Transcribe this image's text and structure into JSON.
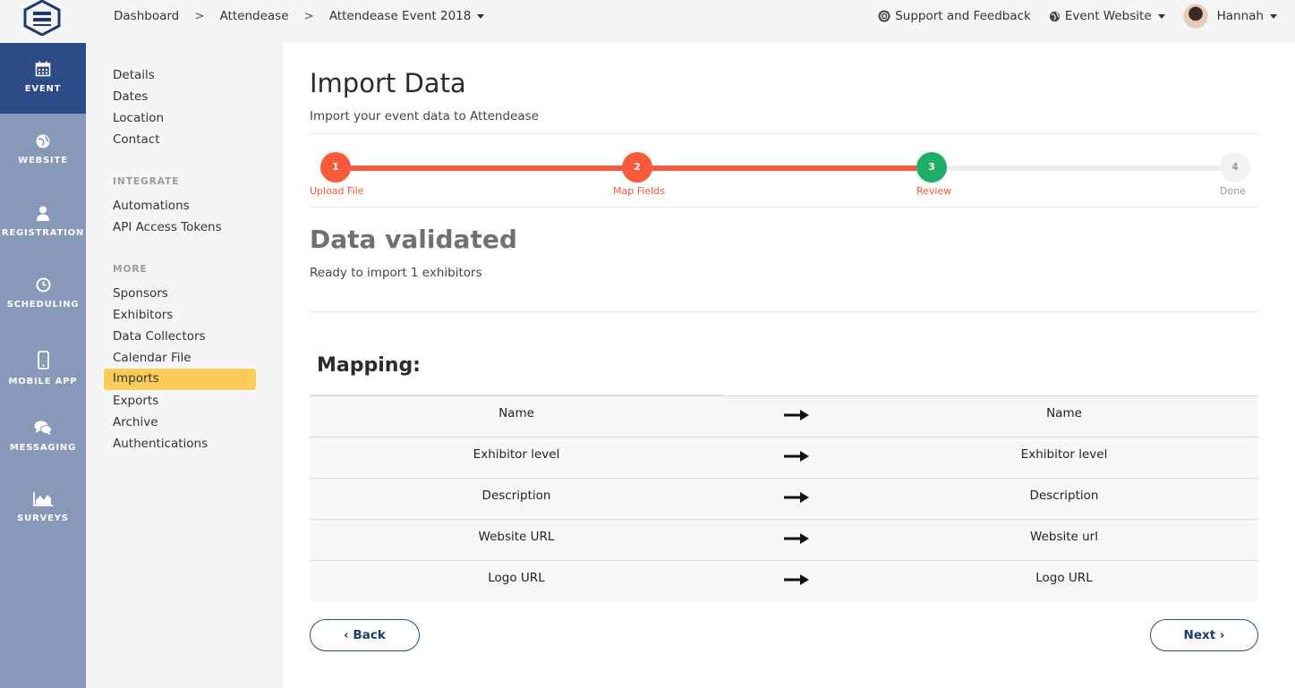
{
  "header": {
    "breadcrumbs": [
      "Dashboard",
      "Attendease",
      "Attendease Event 2018"
    ],
    "breadcrumb_sep": ">",
    "support_label": "Support and Feedback",
    "website_label": "Event Website",
    "user_name": "Hannah"
  },
  "rail": {
    "items": [
      {
        "label": "EVENT",
        "icon": "calendar-icon"
      },
      {
        "label": "WEBSITE",
        "icon": "globe-icon"
      },
      {
        "label": "REGISTRATION",
        "icon": "user-icon"
      },
      {
        "label": "SCHEDULING",
        "icon": "clock-icon"
      },
      {
        "label": "MOBILE APP",
        "icon": "phone-icon"
      },
      {
        "label": "MESSAGING",
        "icon": "chat-icon"
      },
      {
        "label": "SURVEYS",
        "icon": "chart-icon"
      }
    ]
  },
  "subnav": {
    "group1": [
      "Details",
      "Dates",
      "Location",
      "Contact"
    ],
    "integrate_heading": "INTEGRATE",
    "group2": [
      "Automations",
      "API Access Tokens"
    ],
    "more_heading": "MORE",
    "group3": [
      "Sponsors",
      "Exhibitors",
      "Data Collectors",
      "Calendar File",
      "Imports",
      "Exports",
      "Archive",
      "Authentications"
    ]
  },
  "page": {
    "title": "Import Data",
    "subtitle": "Import your event data to Attendease",
    "steps": [
      {
        "number": "1",
        "label": "Upload File"
      },
      {
        "number": "2",
        "label": "Map Fields"
      },
      {
        "number": "3",
        "label": "Review"
      },
      {
        "number": "4",
        "label": "Done"
      }
    ],
    "status_title": "Data validated",
    "status_text": "Ready to import 1 exhibitors",
    "mapping_title": "Mapping:",
    "mapping": [
      {
        "source": "Name",
        "target": "Name"
      },
      {
        "source": "Exhibitor level",
        "target": "Exhibitor level"
      },
      {
        "source": "Description",
        "target": "Description"
      },
      {
        "source": "Website URL",
        "target": "Website url"
      },
      {
        "source": "Logo URL",
        "target": "Logo URL"
      }
    ],
    "back_label": "‹ Back",
    "next_label": "Next ›"
  },
  "colors": {
    "rail_bg": "#8798b9",
    "rail_active": "#2d4b87",
    "step_done": "#fa5a3c",
    "step_current": "#1fae6a",
    "highlight": "#fdcb5a"
  }
}
